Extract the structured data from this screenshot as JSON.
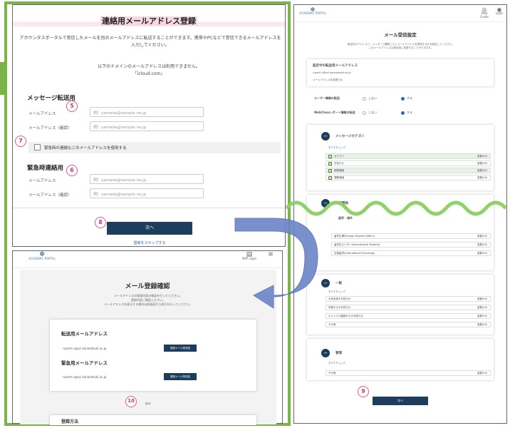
{
  "colors": {
    "frame_green": "#7bb34a",
    "wave_green": "#8fd16a",
    "navy": "#1d3d5c",
    "arrow_blue": "#6a86c8",
    "badge_pink": "#e05a8a",
    "link_blue": "#2a6aa8"
  },
  "panel1": {
    "title": "連絡用メールアドレス登録",
    "intro": "アカウンタスポータルで受信したメールを別のメールアドレスに転送することができます。携帯やPCなどで受信できるメールアドレスを入力してください。",
    "domain_note": "以下のドメインのメールアドレスは利用できません。",
    "domain_value": "「icloud.com」",
    "section_message": "メッセージ転送用",
    "label_email": "メールアドレス",
    "label_email_confirm": "メールアドレス（確認）",
    "placeholder": "例）yamada@sample.ne.jp",
    "checkbox_label": "緊急時の連絡もこのメールアドレスを使用する",
    "section_emergency": "緊急時連絡用",
    "next_button": "次へ",
    "skip_link": "登録をスキップする"
  },
  "badges": {
    "b5": "5",
    "b6": "6",
    "b7": "7",
    "b8": "8",
    "b9": "9",
    "b10": "10"
  },
  "panel2": {
    "logo": "ACADEMIC PORTAL",
    "header_icon_label": "SMP Login",
    "title": "メール登録確認",
    "desc": [
      "メールアドレスの登録内容の確認を行ってください。",
      "登録内容ご確認ください。",
      "メールアドレスを修正する場合は前画面から修正を行ってください。"
    ],
    "transfer_heading": "転送用メールアドレス",
    "transfer_value": "ruamh.n@sci.kanalatsuki.ac.jp",
    "transfer_button": "登録メール再送信",
    "emergency_heading": "緊急用メールアドレス",
    "emergency_value": "ruamh.n@sci.kanalatsuki.ac.jp",
    "emergency_button": "登録メール再送信",
    "back_link": "戻る",
    "bottom_heading": "登録方法"
  },
  "panel3": {
    "logo": "ACADEMIC PORTAL",
    "icon1": "Help Guide",
    "icon2": "Login",
    "title": "メール受信設定",
    "desc": [
      "転送先のアドレスへ、メッセージ種別ごとにメールアドレスを受信するかを設定してください。",
      "このメールアドレスは設定後に変更することができます。"
    ],
    "current_label": "設定中の転送用メールアドレス",
    "current_value": "ruamh.n@sci.kanalatsuki.ac.jp",
    "change_link": "メールアドレスを変更する",
    "setting1_label": "ユーザー情報の転送",
    "setting2_label": "WebClassレポート情報の転送",
    "opt_off": "しない",
    "opt_on": "する",
    "cat1": "メッセージカテゴリ",
    "cat_all": "すべてチェック",
    "cat1_items": [
      "カテゴリ",
      "お知らせ",
      "授業連絡",
      "課題連絡"
    ],
    "status": "重要のみ",
    "cat2": "授業関係",
    "cat2_sub": "留学・海外",
    "cat2_items": [
      "留学生課(Foreign Student Affairs)",
      "留学生センター(International Student)",
      "交換留学(International Exchange)"
    ],
    "cat3": "一般",
    "cat3_items": [
      "大学全体のお知らせ",
      "学部からのお知らせ",
      "キャンパス施設からのお知らせ",
      "その他"
    ],
    "cat4": "管理",
    "cat4_items": [
      "その他"
    ],
    "next_button": "次へ"
  }
}
